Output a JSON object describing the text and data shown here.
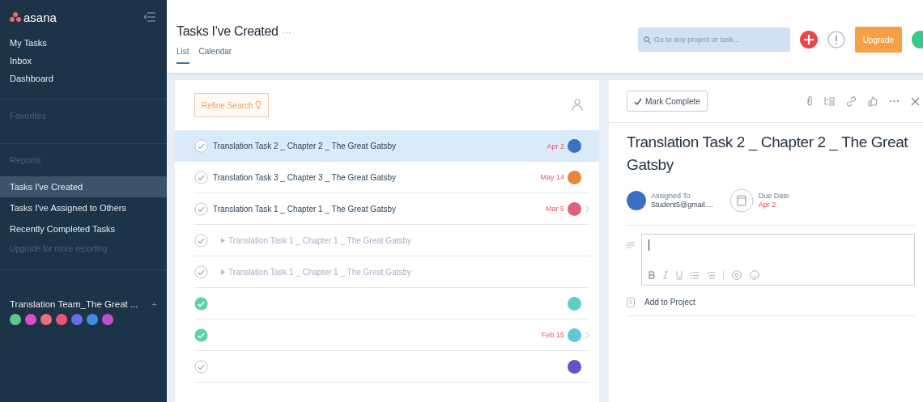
{
  "sidebar": {
    "logo": "asana",
    "nav": [
      {
        "label": "My Tasks"
      },
      {
        "label": "Inbox"
      },
      {
        "label": "Dashboard"
      }
    ],
    "favorites_heading": "Favorites",
    "reports_heading": "Reports",
    "reports": [
      {
        "label": "Tasks I've Created",
        "selected": true
      },
      {
        "label": "Tasks I've Assigned to Others",
        "selected": false
      },
      {
        "label": "Recently Completed Tasks",
        "selected": false
      }
    ],
    "upgrade_link": "Upgrade for more reporting",
    "team": {
      "name": "Translation Team_The Great ...",
      "add": "+",
      "members": [
        {
          "color": "#5ec98f"
        },
        {
          "color": "#d94fc8"
        },
        {
          "color": "#ec6f7c"
        },
        {
          "color": "#e8557a"
        },
        {
          "color": "#6a6ee0"
        },
        {
          "color": "#3f8ee0"
        },
        {
          "color": "#c04fd6"
        }
      ]
    }
  },
  "header": {
    "title": "Tasks I've Created",
    "more": "···",
    "tabs": [
      {
        "label": "List",
        "selected": true
      },
      {
        "label": "Calendar",
        "selected": false
      }
    ],
    "search": {
      "placeholder": "Go to any project or task..."
    },
    "upgrade": "Upgrade"
  },
  "list": {
    "refine": "Refine Search",
    "rows": [
      {
        "kind": "task",
        "title": "Translation Task 2 _ Chapter 2 _ The Great Gatsby",
        "completed": false,
        "selected": true,
        "due": "Apr 2",
        "color": "#3d6fc4",
        "chevron": false
      },
      {
        "kind": "task",
        "title": "Translation Task 3 _ Chapter 3 _ The Great Gatsby",
        "completed": false,
        "selected": false,
        "due": "May 14",
        "color": "#e8873a",
        "chevron": false
      },
      {
        "kind": "task",
        "title": "Translation Task 1 _ Chapter 1 _ The Great Gatsby",
        "completed": false,
        "selected": false,
        "due": "Mar 5",
        "color": "#e0607a",
        "chevron": true
      },
      {
        "kind": "subtask",
        "title": "Translation Task 1 _ Chapter 1 _ The Great Gatsby",
        "completed": false,
        "selected": false,
        "chevron": false
      },
      {
        "kind": "subtask",
        "title": "Translation Task 1 _ Chapter 1 _ The Great Gatsby",
        "completed": false,
        "selected": false,
        "chevron": false
      },
      {
        "kind": "task",
        "completed": true,
        "selected": false,
        "color": "#5ccfc4",
        "chevron": false
      },
      {
        "kind": "task",
        "completed": true,
        "selected": false,
        "due": "Feb 15",
        "color": "#5cc8d8",
        "chevron": true
      },
      {
        "kind": "task",
        "completed": false,
        "selected": false,
        "color": "#6a4fc8",
        "chevron": false
      }
    ]
  },
  "detail": {
    "mark_complete": "Mark Complete",
    "title": "Translation Task 2 _ Chapter 2 _ The Great Gatsby",
    "assignee_label": "Assigned To",
    "assignee": "Student5@gmail....",
    "due_label": "Due Date",
    "due": "Apr 2",
    "add_project": "Add to Project"
  }
}
